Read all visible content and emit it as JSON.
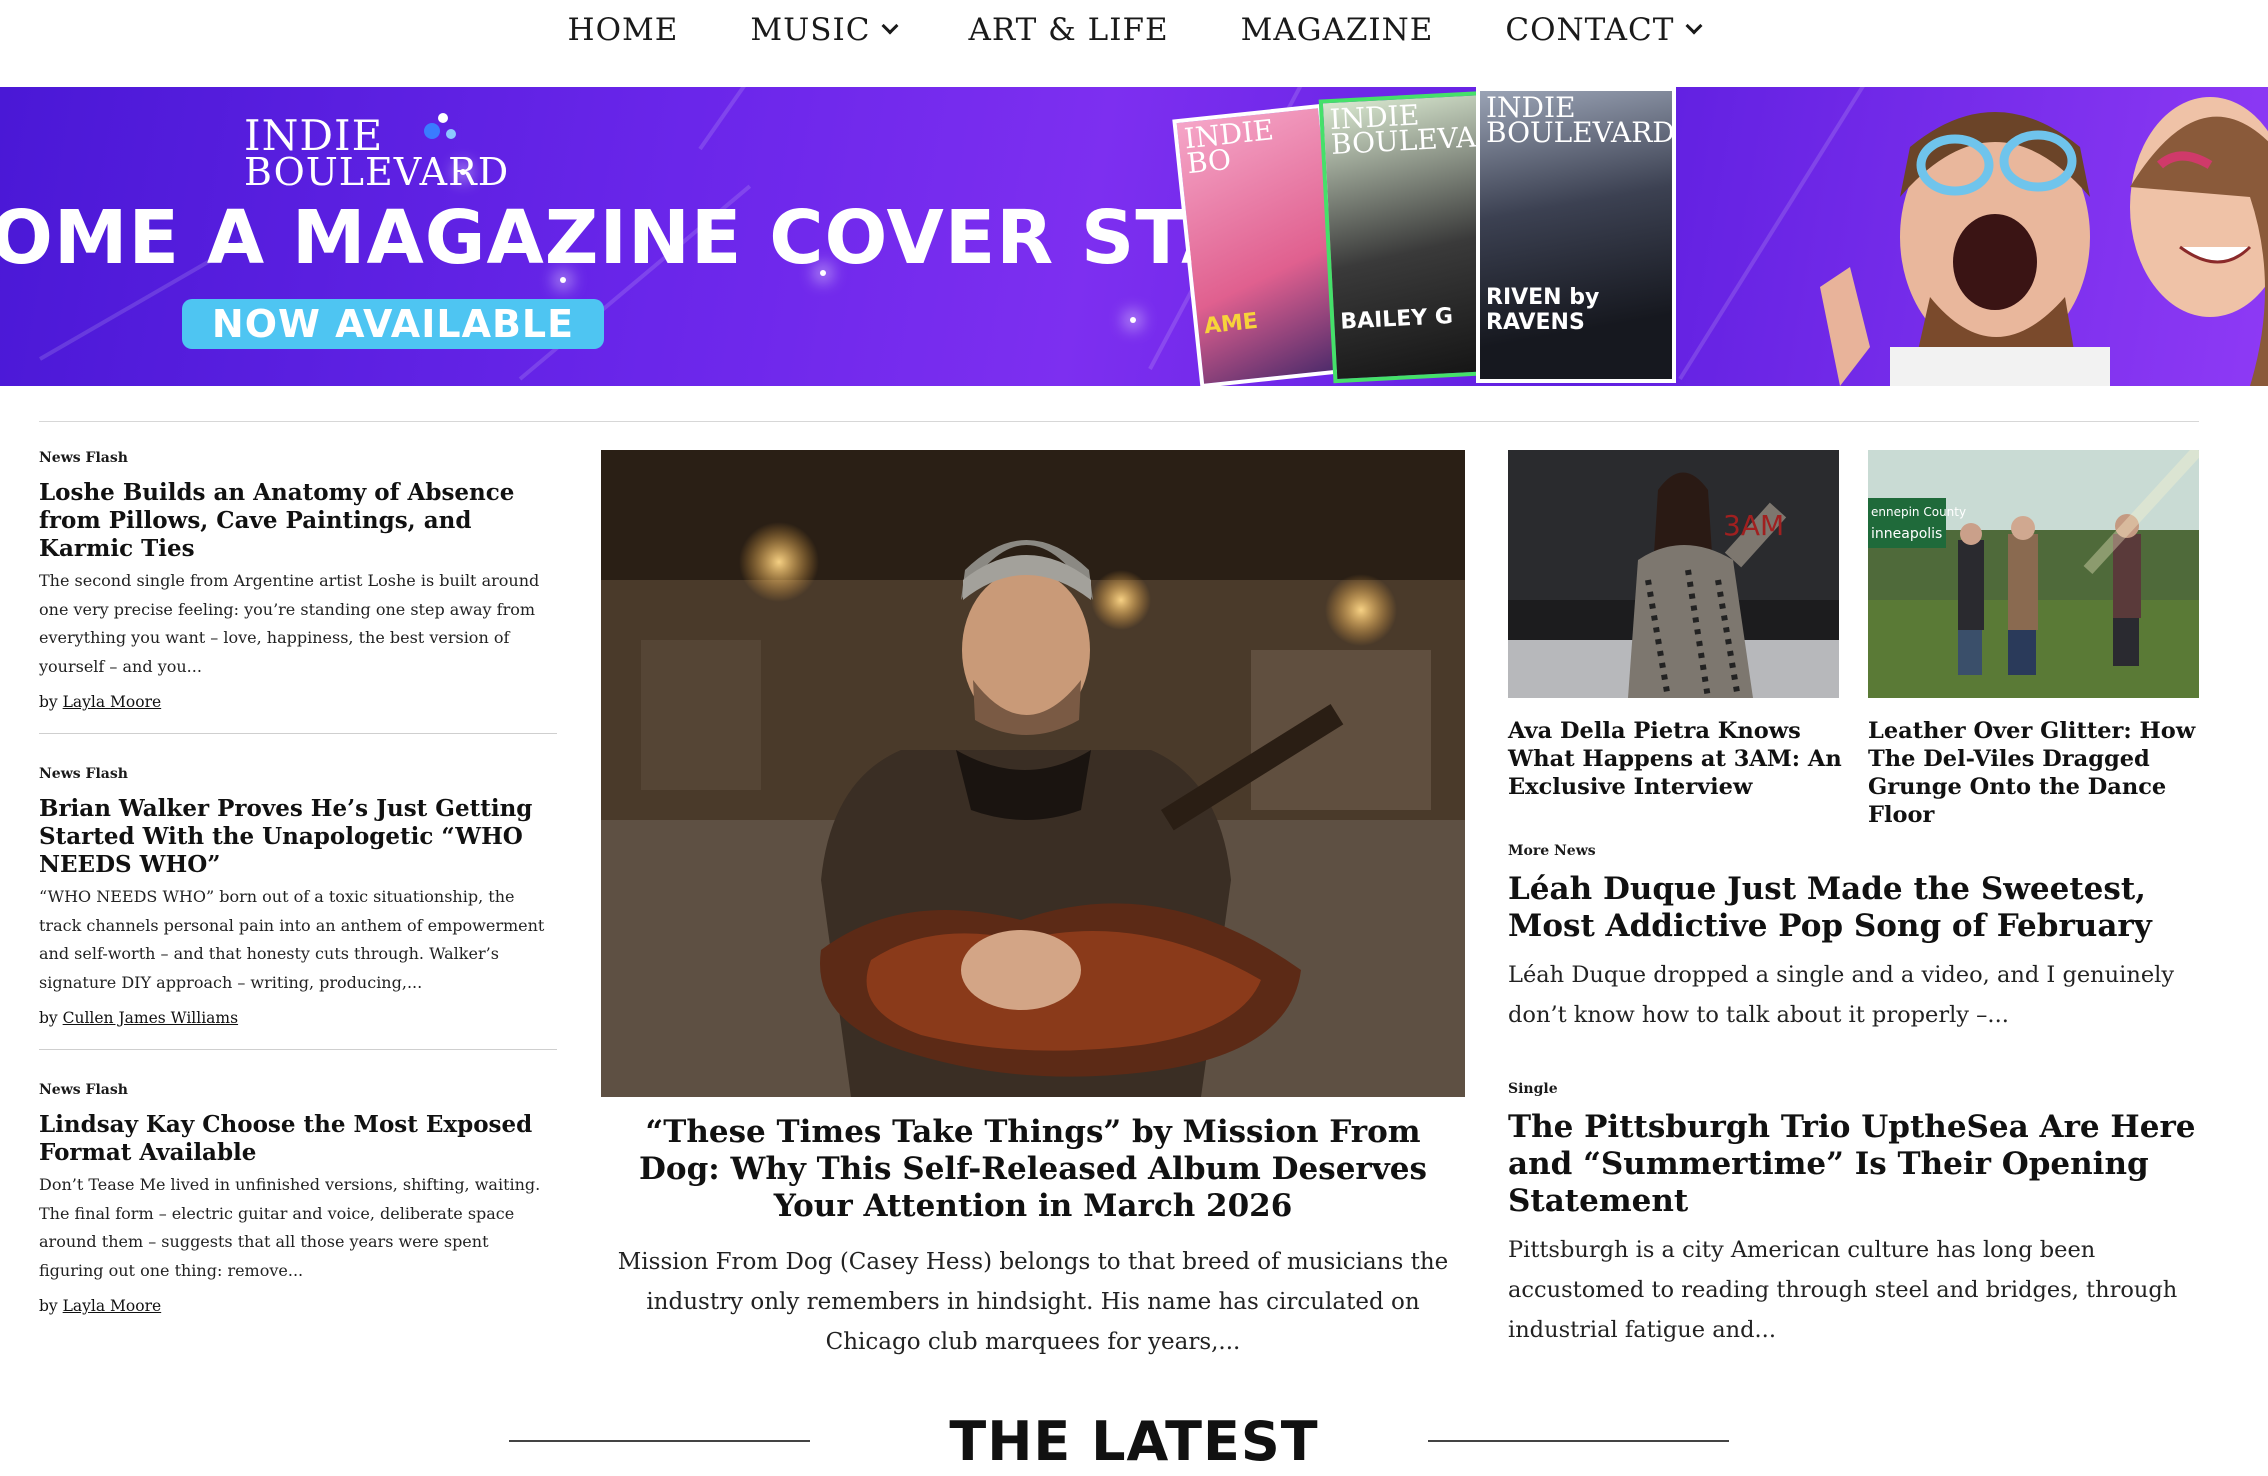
{
  "nav": {
    "items": [
      {
        "label": "HOME"
      },
      {
        "label": "MUSIC"
      },
      {
        "label": "ART & LIFE"
      },
      {
        "label": "MAGAZINE"
      },
      {
        "label": "CONTACT"
      }
    ]
  },
  "banner": {
    "logo_line1": "INDIE",
    "logo_line2": "BOULEVARD",
    "headline": "OME A MAGAZINE COVER STAR",
    "button": "NOW AVAILABLE",
    "cover1_title": "INDIE BO",
    "cover1_name": "AME",
    "cover2_title": "INDIE BOULEVA",
    "cover2_name": "BAILEY G",
    "cover3_title": "INDIE BOULEVARD",
    "cover3_name": "RIVEN by RAVENS",
    "colors": {
      "bg_start": "#4a18d6",
      "bg_end": "#8e3af5",
      "button": "#4ec5f2"
    }
  },
  "left_articles": [
    {
      "kicker": "News Flash",
      "title": "Loshe Builds an Anatomy of Absence from Pillows, Cave Paintings, and Karmic Ties",
      "excerpt": "The second single from Argentine artist Loshe is built around one very precise feeling: you’re standing one step away from everything you want – love, happiness, the best version of yourself – and you...",
      "by": "by",
      "author": "Layla Moore"
    },
    {
      "kicker": "News Flash",
      "title": "Brian Walker Proves He’s Just Getting Started With the Unapologetic “WHO NEEDS WHO”",
      "excerpt": "“WHO NEEDS WHO” born out of a toxic situationship, the track channels personal pain into an anthem of empowerment and self-worth – and that honesty cuts through. Walker’s signature DIY approach – writing, producing,...",
      "by": "by",
      "author": "Cullen James Williams"
    },
    {
      "kicker": "News Flash",
      "title": "Lindsay Kay Choose the Most Exposed Format Available",
      "excerpt": "Don’t Tease Me lived in unfinished versions, shifting, waiting. The final form – electric guitar and voice, deliberate space around them – suggests that all those years were spent figuring out one thing: remove...",
      "by": "by",
      "author": "Layla Moore"
    }
  ],
  "featured": {
    "title": "“These Times Take Things” by Mission From Dog: Why This Self-Released Album Deserves Your Attention in March 2026",
    "excerpt": "Mission From Dog (Casey Hess) belongs to that breed of musicians the industry only remembers in hindsight. His name has circulated on Chicago club marquees for years,..."
  },
  "thumbs": [
    {
      "title": "Ava Della Pietra Knows What Happens at 3AM: An Exclusive Interview",
      "image_text": "3AM"
    },
    {
      "title": "Leather Over Glitter: How The Del-Viles Dragged Grunge Onto the Dance Floor",
      "image_text": "ennepin County",
      "image_text2": "inneapolis"
    }
  ],
  "right_articles": [
    {
      "kicker": "More News",
      "title": "Léah Duque Just Made the Sweetest, Most Addictive Pop Song of February",
      "excerpt": "Léah Duque dropped a single and a video, and I genuinely don’t know how to talk about it properly –..."
    },
    {
      "kicker": "Single",
      "title": "The Pittsburgh Trio UptheSea Are Here and “Summertime” Is Their Opening Statement",
      "excerpt": "Pittsburgh is a city American culture has long been accustomed to reading through steel and bridges, through industrial fatigue and..."
    }
  ],
  "section": {
    "heading": "THE LATEST"
  }
}
